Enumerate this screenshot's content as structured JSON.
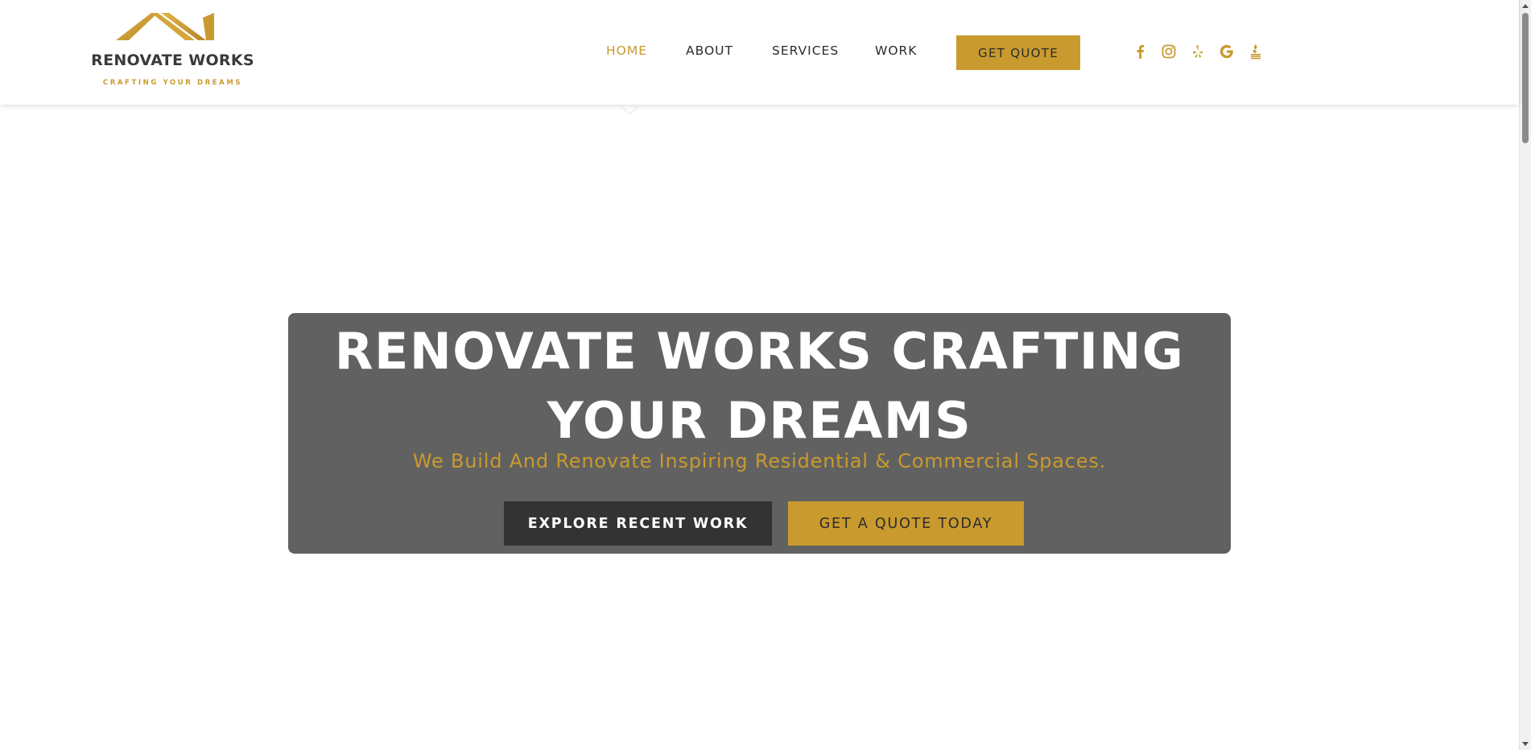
{
  "logo": {
    "title": "RENOVATE WORKS",
    "tagline": "CRAFTING YOUR DREAMS",
    "icon": "house-roof-logo-icon"
  },
  "nav": {
    "items": [
      {
        "label": "HOME",
        "active": true
      },
      {
        "label": "ABOUT",
        "active": false
      },
      {
        "label": "SERVICES",
        "active": false
      },
      {
        "label": "WORK",
        "active": false
      }
    ],
    "quote_button": "GET QUOTE"
  },
  "social": [
    {
      "icon": "facebook-icon"
    },
    {
      "icon": "instagram-icon"
    },
    {
      "icon": "yelp-icon"
    },
    {
      "icon": "google-icon"
    },
    {
      "icon": "bbb-icon"
    }
  ],
  "hero": {
    "title": "RENOVATE WORKS CRAFTING YOUR DREAMS",
    "subtitle": "We Build And Renovate Inspiring Residential & Commercial Spaces.",
    "primary_button": "EXPLORE RECENT WORK",
    "secondary_button": "GET A QUOTE TODAY"
  },
  "colors": {
    "accent_gold": "#c99a2e",
    "dark": "#333333",
    "hero_box": "#616161",
    "text": "#2c2c2c"
  }
}
